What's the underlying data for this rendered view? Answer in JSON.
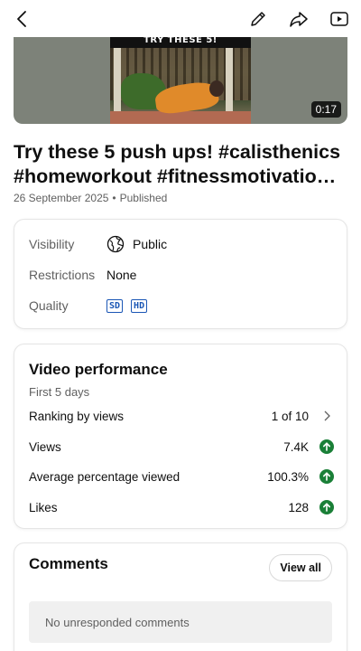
{
  "topbar": {
    "back_icon": "arrow-left-icon",
    "edit_icon": "pencil-icon",
    "share_icon": "share-icon",
    "play_icon": "youtube-play-icon"
  },
  "video": {
    "thumbnail_caption": "TRY THESE 5!",
    "duration": "0:17",
    "title_line1": "Try these 5 push ups! #calisthenics",
    "title_line2": "#homeworkout #fitnessmotivatio…",
    "date": "26 September 2025",
    "status": "Published"
  },
  "details": {
    "visibility_label": "Visibility",
    "visibility_value": "Public",
    "restrictions_label": "Restrictions",
    "restrictions_value": "None",
    "quality_label": "Quality",
    "quality_badges": [
      "SD",
      "HD"
    ]
  },
  "performance": {
    "title": "Video performance",
    "period": "First 5 days",
    "rows": [
      {
        "label": "Ranking by views",
        "value": "1 of 10",
        "indicator": "chevron"
      },
      {
        "label": "Views",
        "value": "7.4K",
        "indicator": "up"
      },
      {
        "label": "Average percentage viewed",
        "value": "100.3%",
        "indicator": "up"
      },
      {
        "label": "Likes",
        "value": "128",
        "indicator": "up"
      }
    ]
  },
  "comments": {
    "title": "Comments",
    "view_all": "View all",
    "empty_text": "No unresponded comments"
  },
  "colors": {
    "up_indicator": "#1a7f37",
    "quality_badge": "#1a56b5"
  }
}
